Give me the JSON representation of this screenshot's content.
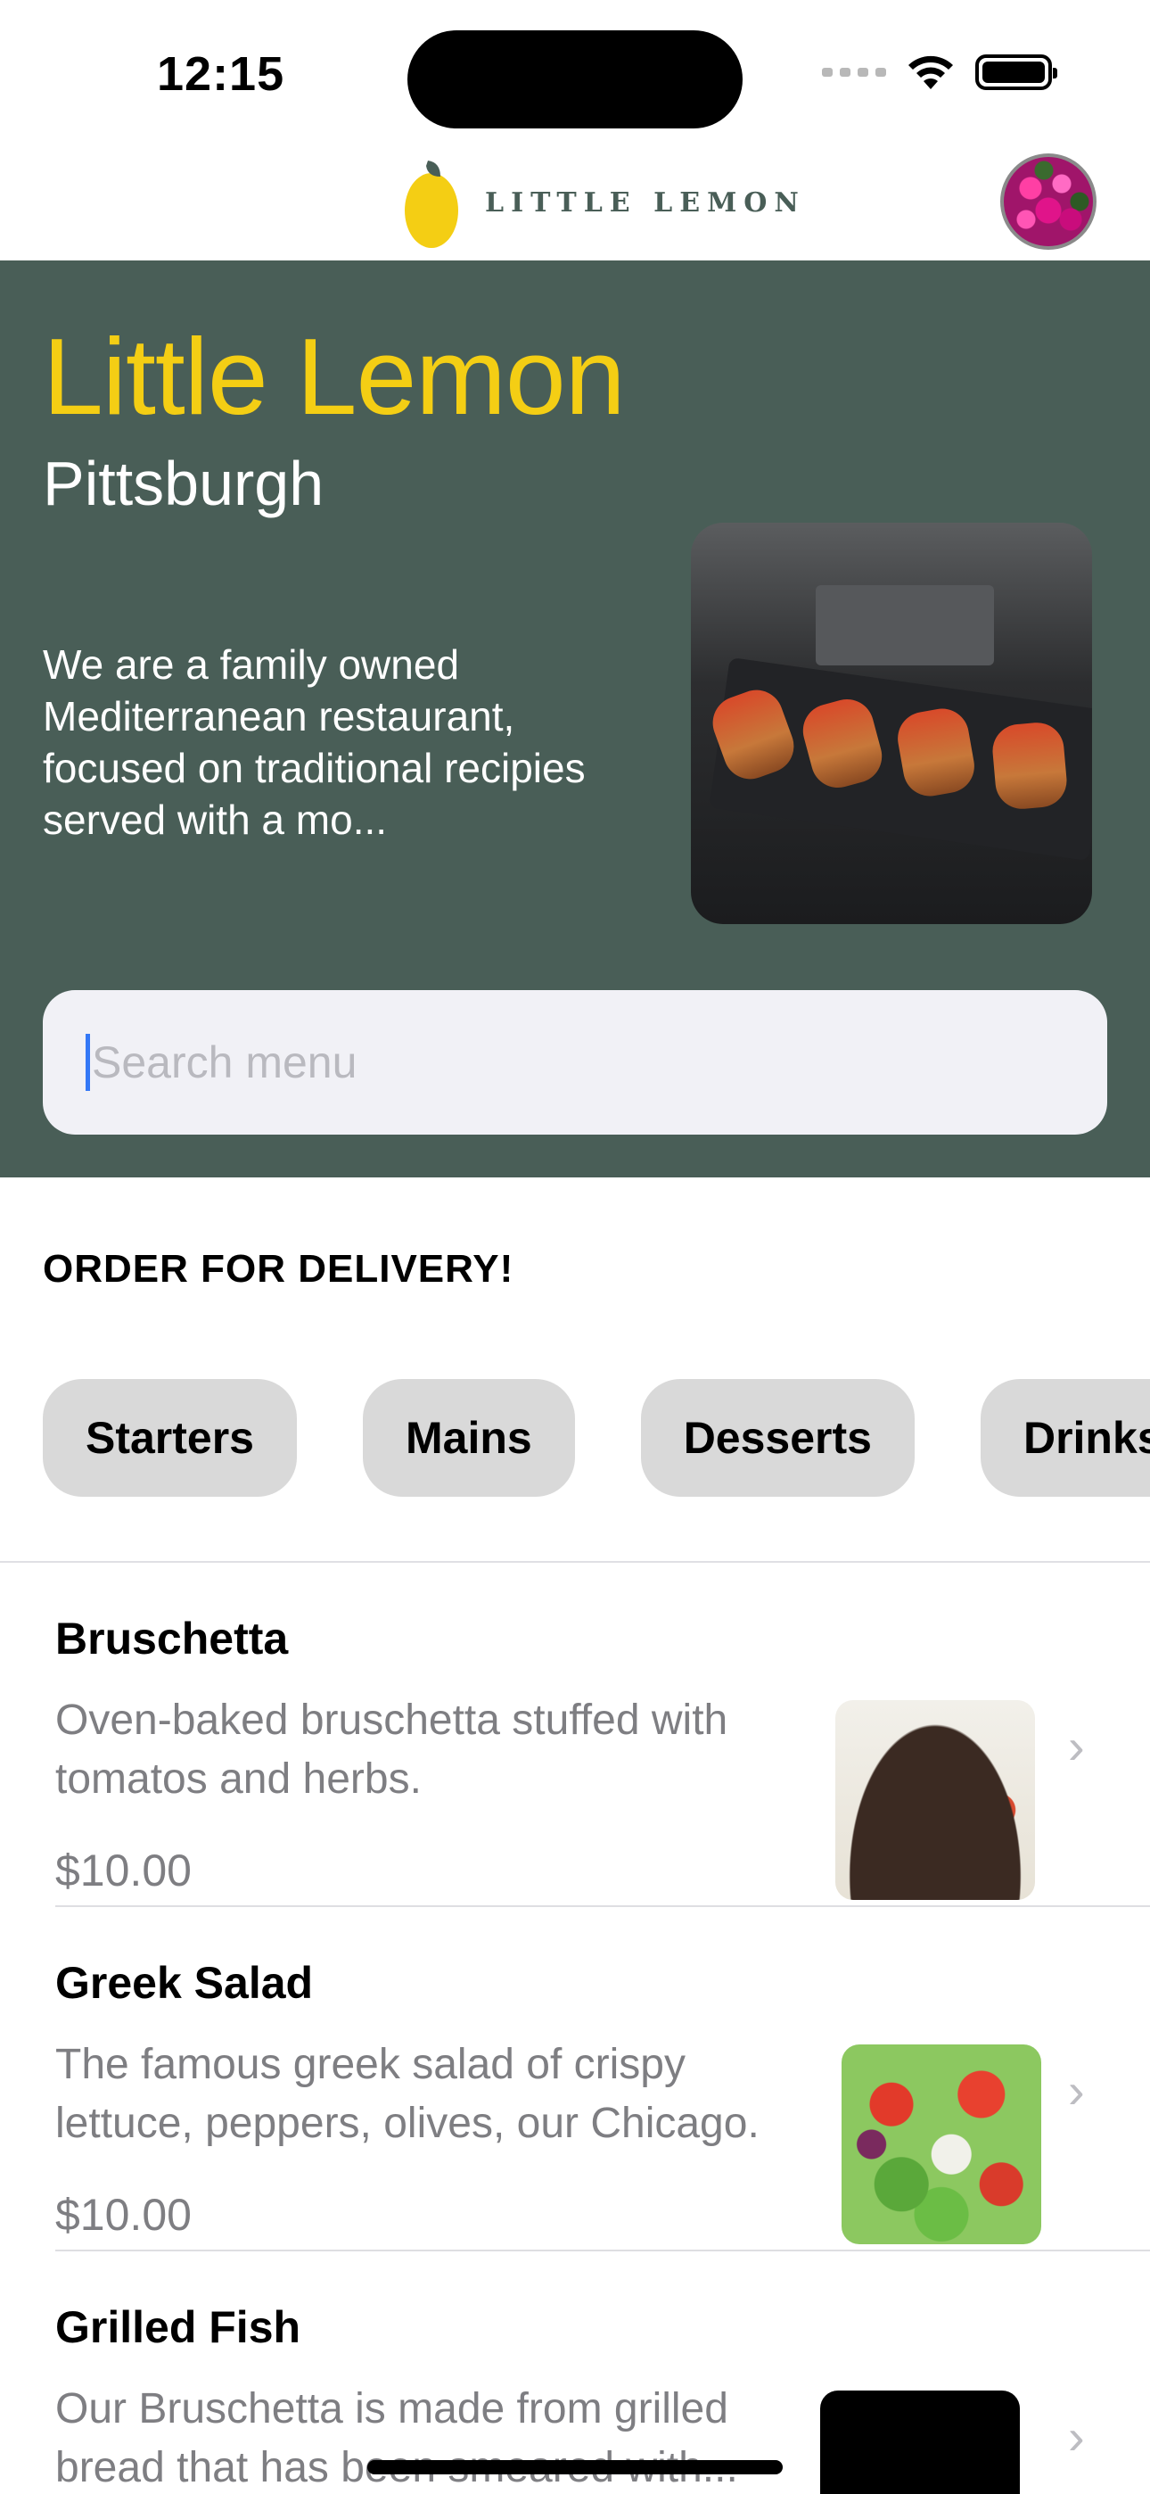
{
  "status_bar": {
    "time": "12:15"
  },
  "header": {
    "logo_text": "LITTLE LEMON",
    "logo_icon": "lemon-icon",
    "avatar_icon": "profile-avatar"
  },
  "hero": {
    "title": "Little Lemon",
    "city": "Pittsburgh",
    "description": "We are a family owned Mediterranean restaurant, focused on traditional recipies served with a mo...",
    "colors": {
      "background": "#495e57",
      "title": "#f4ce14"
    }
  },
  "search": {
    "placeholder": "Search menu",
    "value": ""
  },
  "order": {
    "title": "ORDER FOR DELIVERY!",
    "categories": [
      "Starters",
      "Mains",
      "Desserts",
      "Drinks"
    ]
  },
  "menu": {
    "items": [
      {
        "name": "Bruschetta",
        "description": "Oven-baked bruschetta stuffed with tomatos and herbs.",
        "price": "$10.00"
      },
      {
        "name": "Greek Salad",
        "description": "The famous greek salad of crispy lettuce, peppers, olives, our Chicago.",
        "price": "$10.00"
      },
      {
        "name": "Grilled Fish",
        "description": "Our Bruschetta is made from grilled bread that has been smeared with...",
        "price": ""
      }
    ]
  }
}
